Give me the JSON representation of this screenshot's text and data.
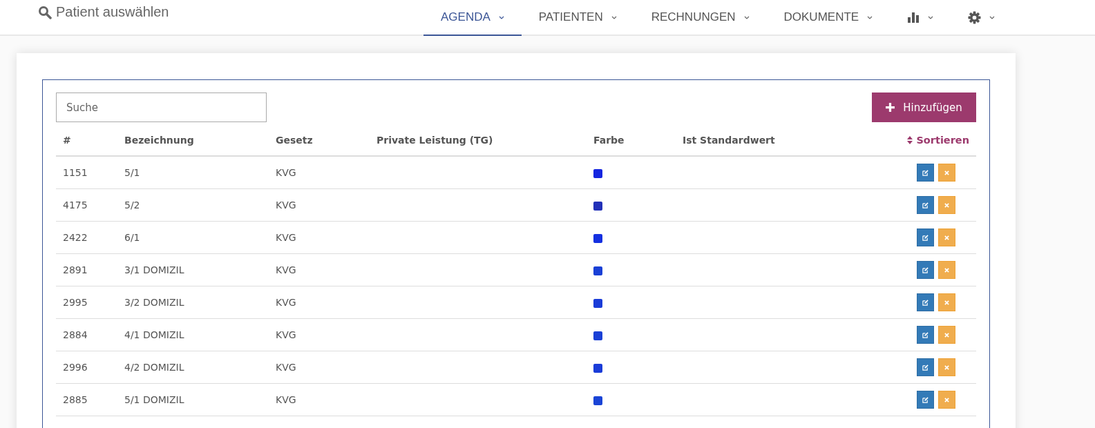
{
  "patient_search": {
    "label": "Patient auswählen"
  },
  "nav": [
    {
      "label": "AGENDA",
      "kind": "text",
      "selected": true
    },
    {
      "label": "PATIENTEN",
      "kind": "text",
      "selected": false
    },
    {
      "label": "RECHNUNGEN",
      "kind": "text",
      "selected": false
    },
    {
      "label": "DOKUMENTE",
      "kind": "text",
      "selected": false
    },
    {
      "kind": "chart",
      "selected": false
    },
    {
      "kind": "settings",
      "selected": false
    }
  ],
  "search": {
    "placeholder": "Suche"
  },
  "add_button": {
    "label": "Hinzufügen"
  },
  "table": {
    "columns": [
      "#",
      "Bezeichnung",
      "Gesetz",
      "Private Leistung (TG)",
      "Farbe",
      "Ist Standardwert"
    ],
    "sort_label": "Sortieren",
    "rows": [
      {
        "id": "1151",
        "name": "5/1",
        "law": "KVG",
        "color": "#1425e0"
      },
      {
        "id": "4175",
        "name": "5/2",
        "law": "KVG",
        "color": "#2231b8"
      },
      {
        "id": "2422",
        "name": "6/1",
        "law": "KVG",
        "color": "#1430e0"
      },
      {
        "id": "2891",
        "name": "3/1 DOMIZIL",
        "law": "KVG",
        "color": "#1a40d6"
      },
      {
        "id": "2995",
        "name": "3/2 DOMIZIL",
        "law": "KVG",
        "color": "#1a3cd8"
      },
      {
        "id": "2884",
        "name": "4/1 DOMIZIL",
        "law": "KVG",
        "color": "#1a40d6"
      },
      {
        "id": "2996",
        "name": "4/2 DOMIZIL",
        "law": "KVG",
        "color": "#1a3cd8"
      },
      {
        "id": "2885",
        "name": "5/1 DOMIZIL",
        "law": "KVG",
        "color": "#1a44d6"
      }
    ]
  }
}
